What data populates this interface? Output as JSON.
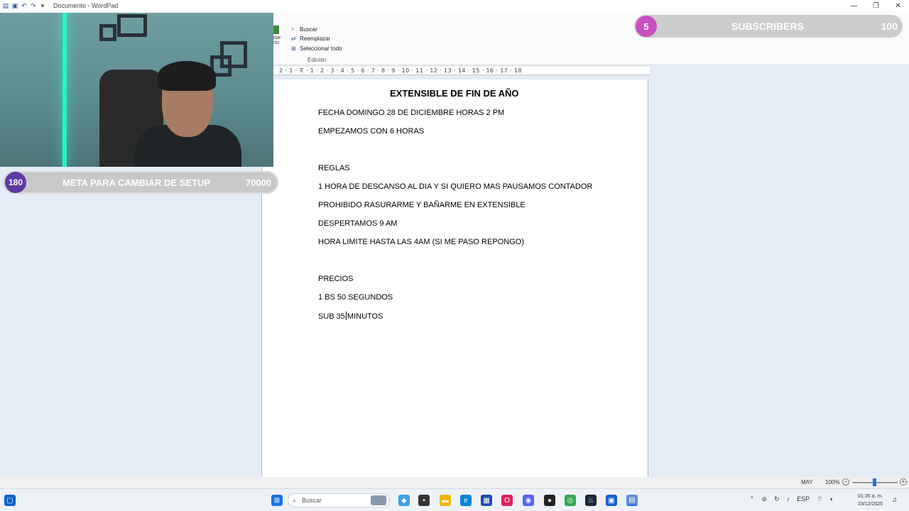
{
  "window": {
    "title": "Documento - WordPad",
    "controls": {
      "minimize": "—",
      "maximize": "❐",
      "close": "✕"
    }
  },
  "ribbon": {
    "cut_label": "rtar\nrto",
    "edit_items": [
      {
        "icon": "binoculars-icon",
        "label": "Buscar"
      },
      {
        "icon": "replace-icon",
        "label": "Reemplazar"
      },
      {
        "icon": "select-all-icon",
        "label": "Seleccionar todo"
      }
    ],
    "group_label": "Edición"
  },
  "ruler": {
    "text": "2 · 1 · ⊼ · 1 · 2 · 3 · 4 · 5 · 6 · 7 · 8 · 9 · 10 · 11 · 12 · 13 · 14 · 15 · 16 · 17 · 18"
  },
  "document": {
    "title": "EXTENSIBLE DE FIN DE AÑO",
    "lines": [
      "FECHA DOMINGO 28 DE DICIEMBRE HORAS 2 PM",
      "EMPEZAMOS CON 6 HORAS",
      "REGLAS",
      "1 HORA DE DESCANSO AL DIA Y SI QUIERO MAS PAUSAMOS CONTADOR",
      "PROHIBIDO RASURARME Y BAÑARME EN EXTENSIBLE",
      "DESPERTAMOS 9 AM",
      "HORA LIMITE HASTA LAS 4AM (SI ME PASO REPONGO)",
      "PRECIOS",
      "1 BS 50 SEGUNDOS"
    ],
    "last_line_before_cursor": "SUB 35",
    "last_line_after_cursor": "MINUTOS"
  },
  "goal_setup": {
    "count": "180",
    "label": "META PARA CAMBIAR DE SETUP",
    "target": "70000"
  },
  "subscribers_goal": {
    "count": "5",
    "label": "SUBSCRIBERS",
    "target": "100"
  },
  "statusbar": {
    "caps": "MAY",
    "zoom": "100%",
    "zoom_level_percent": 100
  },
  "taskbar": {
    "search_placeholder": "Buscar",
    "tray_lang": "ESP",
    "clock_time": "01:35 a. m.",
    "clock_date": "23/12/2025"
  }
}
